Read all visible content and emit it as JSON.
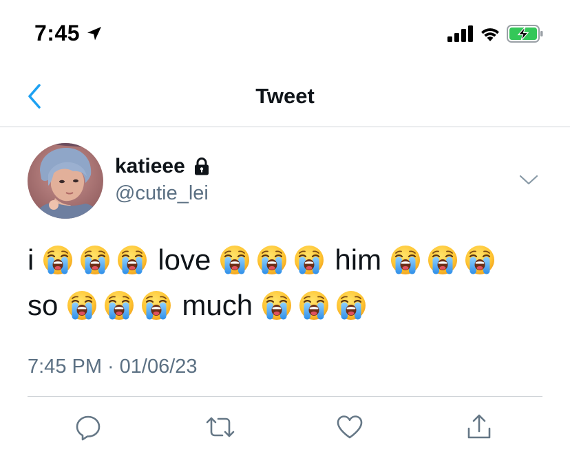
{
  "status_bar": {
    "time": "7:45",
    "icons": [
      "location-arrow-icon",
      "cellular-signal-icon",
      "wifi-icon",
      "battery-charging-icon"
    ],
    "battery_color": "#34c759"
  },
  "nav": {
    "title": "Tweet",
    "back_icon": "chevron-left-icon",
    "accent_color": "#1da1f2"
  },
  "tweet": {
    "author": {
      "display_name": "katieee",
      "handle": "@cutie_lei",
      "protected_icon": "lock-icon"
    },
    "body": {
      "line1": {
        "w1": "i",
        "w2": "love",
        "w3": "him"
      },
      "line2": {
        "w1": "so",
        "w2": "much"
      },
      "emoji": "loudly-crying-face-emoji"
    },
    "timestamp": {
      "time": "7:45 PM",
      "separator": "·",
      "date": "01/06/23"
    },
    "actions": [
      "reply-icon",
      "retweet-icon",
      "like-icon",
      "share-icon"
    ],
    "meta_color": "#5b7083"
  }
}
